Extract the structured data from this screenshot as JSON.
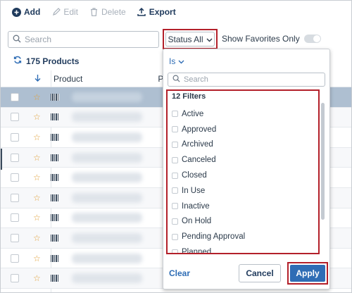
{
  "toolbar": {
    "add_label": "Add",
    "edit_label": "Edit",
    "delete_label": "Delete",
    "export_label": "Export"
  },
  "search": {
    "placeholder": "Search"
  },
  "status_filter": {
    "label": "Status All"
  },
  "favorites": {
    "label": "Show Favorites Only"
  },
  "product_count": "175 Products",
  "table": {
    "columns": [
      "Product",
      "P"
    ],
    "row_count": 10,
    "selected_row": 0
  },
  "dropdown": {
    "operator": "Is",
    "search_placeholder": "Search",
    "filters_title": "12  Filters",
    "filters": [
      "Active",
      "Approved",
      "Archived",
      "Canceled",
      "Closed",
      "In Use",
      "Inactive",
      "On Hold",
      "Pending Approval",
      "Planned"
    ],
    "clear_label": "Clear",
    "cancel_label": "Cancel",
    "apply_label": "Apply"
  },
  "colors": {
    "accent": "#2f6db5",
    "highlight_border": "#b3202a",
    "selected_row": "#aebfd1",
    "star": "#e0a03a"
  }
}
